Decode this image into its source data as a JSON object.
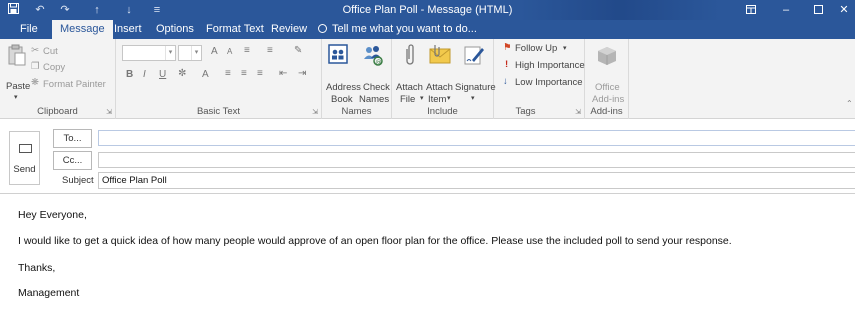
{
  "window": {
    "title": "Office Plan Poll - Message (HTML)",
    "quick_access": {
      "save_icon": "save-icon",
      "undo_icon": "undo-icon",
      "redo_icon": "redo-icon",
      "up_icon": "arrow-up-icon",
      "down_icon": "arrow-down-icon",
      "customize_icon": "customize-icon"
    },
    "controls": [
      "ribbon-display-icon",
      "minimize-icon",
      "maximize-icon",
      "close-icon"
    ]
  },
  "tabs": [
    {
      "label": "File",
      "active": false
    },
    {
      "label": "Message",
      "active": true
    },
    {
      "label": "Insert",
      "active": false
    },
    {
      "label": "Options",
      "active": false
    },
    {
      "label": "Format Text",
      "active": false
    },
    {
      "label": "Review",
      "active": false
    }
  ],
  "tell_me": "Tell me what you want to do...",
  "ribbon": {
    "clipboard": {
      "label": "Clipboard",
      "paste": "Paste",
      "cut": "Cut",
      "copy": "Copy",
      "format_painter": "Format Painter"
    },
    "basic_text": {
      "label": "Basic Text",
      "bold": "B",
      "italic": "I",
      "underline": "U",
      "font_grow": "A",
      "font_shrink": "A",
      "font_color": "A"
    },
    "names": {
      "label": "Names",
      "address_book": [
        "Address",
        "Book"
      ],
      "check_names": [
        "Check",
        "Names"
      ]
    },
    "include": {
      "label": "Include",
      "attach_file": [
        "Attach",
        "File"
      ],
      "attach_item": [
        "Attach",
        "Item"
      ],
      "signature": [
        "Signature",
        ""
      ]
    },
    "tags": {
      "label": "Tags",
      "follow_up": "Follow Up",
      "high_importance": "High Importance",
      "low_importance": "Low Importance"
    },
    "addins": {
      "label": "Add-ins",
      "office_addins": [
        "Office",
        "Add-ins"
      ]
    }
  },
  "compose": {
    "send": "Send",
    "to_button": "To...",
    "cc_button": "Cc...",
    "to_value": "",
    "cc_value": "",
    "subject_label": "Subject",
    "subject_value": "Office Plan Poll"
  },
  "message": {
    "lines": [
      "Hey Everyone,",
      "I would like to get a quick idea of how many people would approve of an open floor plan for the office. Please use the included poll to send your response.",
      "Thanks,",
      "Management"
    ]
  },
  "colors": {
    "accent": "#2b579a",
    "ribbon_bg": "#f3f3f3",
    "follow_up_flag": "#d24726",
    "high_importance": "#c42b1c",
    "low_importance": "#2b579a"
  }
}
